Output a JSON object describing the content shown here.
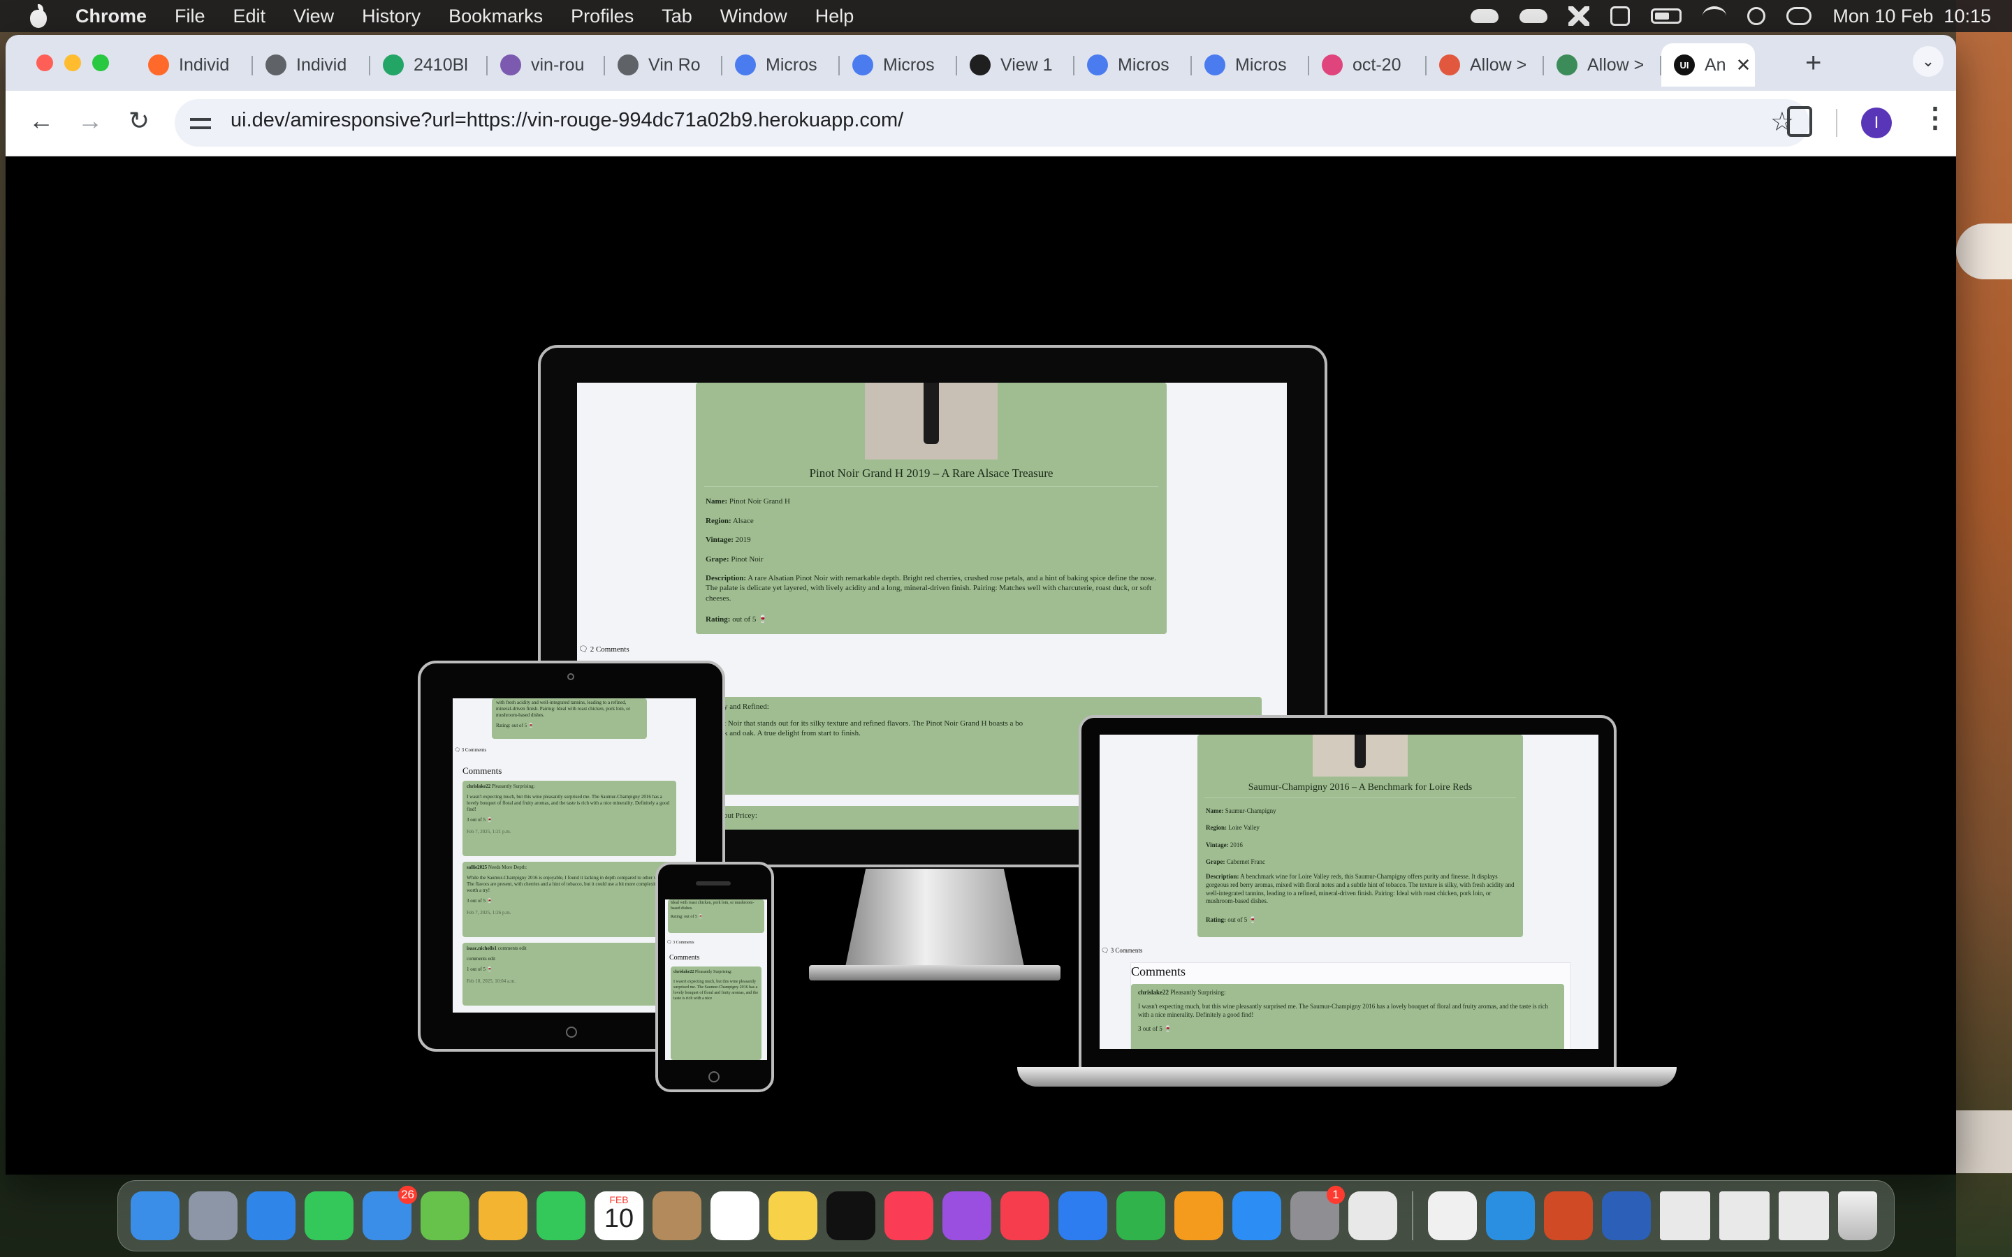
{
  "menubar": {
    "app": "Chrome",
    "items": [
      "File",
      "Edit",
      "View",
      "History",
      "Bookmarks",
      "Profiles",
      "Tab",
      "Window",
      "Help"
    ],
    "datetime": "Mon 10 Feb  10:15"
  },
  "tabs": [
    {
      "label": "Individ",
      "color": "#ff6a2a"
    },
    {
      "label": "Individ",
      "color": "#5f6368"
    },
    {
      "label": "2410Bl",
      "color": "#23a566"
    },
    {
      "label": "vin-rou",
      "color": "#7b5ab0"
    },
    {
      "label": "Vin Ro",
      "color": "#5f6368"
    },
    {
      "label": "Micros",
      "color": "#4a7cf0"
    },
    {
      "label": "Micros",
      "color": "#4a7cf0"
    },
    {
      "label": "View 1",
      "color": "#1f1f1f"
    },
    {
      "label": "Micros",
      "color": "#4a7cf0"
    },
    {
      "label": "Micros",
      "color": "#4a7cf0"
    },
    {
      "label": "oct-20",
      "color": "#e0447c"
    },
    {
      "label": "Allow >",
      "color": "#e2583e"
    },
    {
      "label": "Allow >",
      "color": "#3c8c5a"
    }
  ],
  "active_tab": {
    "label": "An",
    "favicon": "UI"
  },
  "address": {
    "url": "ui.dev/amiresponsive?url=https://vin-rouge-994dc71a02b9.herokuapp.com/"
  },
  "profile_initial": "I",
  "monitor": {
    "title": "Pinot Noir Grand H 2019 – A Rare Alsace Treasure",
    "name_label": "Name:",
    "name": "Pinot Noir Grand H",
    "region_label": "Region:",
    "region": "Alsace",
    "vintage_label": "Vintage:",
    "vintage": "2019",
    "grape_label": "Grape:",
    "grape": "Pinot Noir",
    "description_label": "Description:",
    "description": "A rare Alsatian Pinot Noir with remarkable depth. Bright red cherries, crushed rose petals, and a hint of baking spice define the nose. The palate is delicate yet layered, with lively acidity and a long, mineral-driven finish. Pairing: Matches well with charcuterie, roast duck, or soft cheeses.",
    "rating_label": "Rating:",
    "rating": "out of 5 🍷",
    "comments_count": "🗨 2 Comments",
    "comments_heading_tail": "s",
    "comment_title_tail": "y and Refined:",
    "comment_body_tail": "t Noir that stands out for its silky texture and refined flavors. The Pinot Noir Grand H boasts a bo",
    "comment_body_tail2": "k and oak. A true delight from start to finish.",
    "comment2_tail": "but Pricey:"
  },
  "laptop": {
    "title": "Saumur-Champigny 2016 – A Benchmark for Loire Reds",
    "name_label": "Name:",
    "name": "Saumur-Champigny",
    "region_label": "Region:",
    "region": "Loire Valley",
    "vintage_label": "Vintage:",
    "vintage": "2016",
    "grape_label": "Grape:",
    "grape": "Cabernet Franc",
    "description_label": "Description:",
    "description": "A benchmark wine for Loire Valley reds, this Saumur-Champigny offers purity and finesse. It displays gorgeous red berry aromas, mixed with floral notes and a subtle hint of tobacco. The texture is silky, with fresh acidity and well-integrated tannins, leading to a refined, mineral-driven finish. Pairing: Ideal with roast chicken, pork loin, or mushroom-based dishes.",
    "rating_label": "Rating:",
    "rating": "out of 5 🍷",
    "comments_count": "🗨 3 Comments",
    "comments_heading": "Comments",
    "comment_author": "chrislake22",
    "comment_title": "Pleasantly Surprising:",
    "comment_body": "I wasn't expecting much, but this wine pleasantly surprised me. The Saumur-Champigny 2016 has a lovely bouquet of floral and fruity aromas, and the taste is rich with a nice minerality. Definitely a good find!",
    "comment_rating": "3 out of 5 🍷"
  },
  "tablet": {
    "top_text": "with fresh acidity and well-integrated tannins, leading to a refined, mineral-driven finish. Pairing: Ideal with roast chicken, pork loin, or mushroom-based dishes.",
    "rating": "Rating: out of 5 🍷",
    "comments_count": "🗨 3 Comments",
    "comments_heading": "Comments",
    "c1_author": "chrislake22",
    "c1_title": "Pleasantly Surprising:",
    "c1_body": "I wasn't expecting much, but this wine pleasantly surprised me. The Saumur-Champigny 2016 has a lovely bouquet of floral and fruity aromas, and the taste is rich with a nice minerality. Definitely a good find!",
    "c1_rating": "3 out of 5 🍷",
    "c1_date": "Feb 7, 2025, 1:21 p.m.",
    "c2_author": "sallie2025",
    "c2_title": "Needs More Depth:",
    "c2_body": "While the Saumur-Champigny 2016 is enjoyable, I found it lacking in depth compared to other vintages. The flavors are present, with cherries and a hint of tobacco, but it could use a bit more complexity. Still worth a try!",
    "c2_rating": "3 out of 5 🍷",
    "c2_date": "Feb 7, 2025, 1:26 p.m.",
    "c3_author": "isaac.nicholls1",
    "c3_title": "comments edit",
    "c3_body": "comments edit",
    "c3_rating": "1 out of 5 🍷",
    "c3_date": "Feb 10, 2025, 10:04 a.m."
  },
  "phone": {
    "top_text": "Ideal with roast chicken, pork loin, or mushroom-based dishes.",
    "rating": "Rating: out of 5 🍷",
    "comments_count": "🗨 3 Comments",
    "comments_heading": "Comments",
    "c1_author": "chrislake22",
    "c1_title": "Pleasantly Surprising:",
    "c1_body": "I wasn't expecting much, but this wine pleasantly surprised me. The Saumur-Champigny 2016 has a lovely bouquet of floral and fruity aromas, and the taste is rich with a nice"
  },
  "dock": {
    "mail_badge": "26",
    "calendar_month": "FEB",
    "calendar_day": "10",
    "settings_badge": "1",
    "apps": [
      {
        "name": "finder",
        "color": "#3a8ee8"
      },
      {
        "name": "launchpad",
        "color": "#8d96a6"
      },
      {
        "name": "safari",
        "color": "#2f86e8"
      },
      {
        "name": "messages",
        "color": "#34c759"
      },
      {
        "name": "mail",
        "color": "#3a8ee8"
      },
      {
        "name": "maps",
        "color": "#66c24b"
      },
      {
        "name": "photos",
        "color": "#f2b431"
      },
      {
        "name": "facetime",
        "color": "#34c759"
      },
      {
        "name": "calendar",
        "color": "#ffffff"
      },
      {
        "name": "contacts",
        "color": "#b38a5c"
      },
      {
        "name": "reminders",
        "color": "#ffffff"
      },
      {
        "name": "notes",
        "color": "#f7d147"
      },
      {
        "name": "apple-tv",
        "color": "#111111"
      },
      {
        "name": "music",
        "color": "#fa3c55"
      },
      {
        "name": "podcasts",
        "color": "#9b4fe0"
      },
      {
        "name": "news",
        "color": "#f53d4e"
      },
      {
        "name": "keynote",
        "color": "#2d7cf0"
      },
      {
        "name": "numbers",
        "color": "#2fb34a"
      },
      {
        "name": "pages",
        "color": "#f49b1e"
      },
      {
        "name": "app-store",
        "color": "#2c8ef5"
      },
      {
        "name": "system-settings",
        "color": "#8e8e93"
      },
      {
        "name": "chrome",
        "color": "#e8e8e8"
      },
      {
        "name": "face-app",
        "color": "#f0f0f0"
      },
      {
        "name": "vscode",
        "color": "#2a8fe0"
      },
      {
        "name": "powerpoint",
        "color": "#d04a25"
      },
      {
        "name": "word",
        "color": "#2b5fb8"
      }
    ]
  }
}
